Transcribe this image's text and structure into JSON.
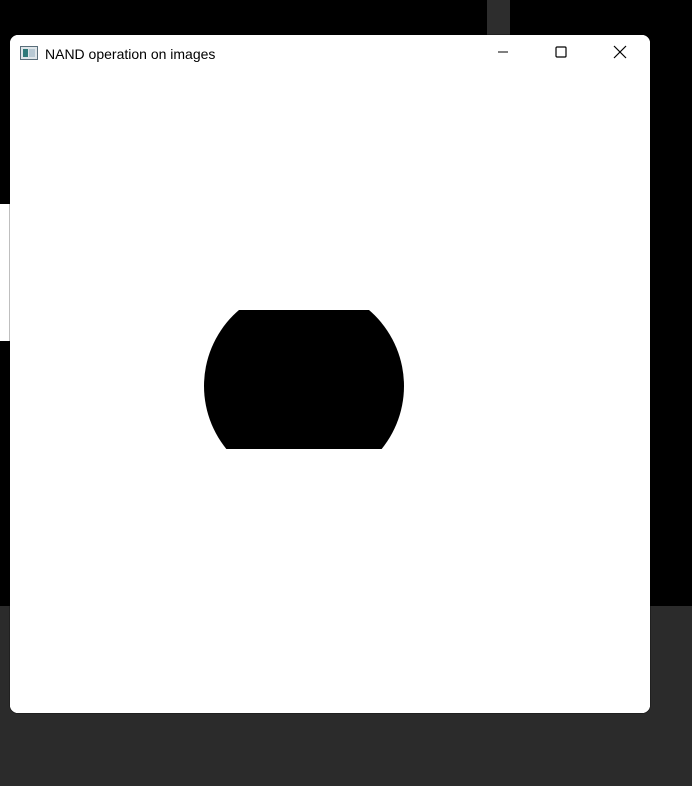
{
  "window": {
    "title": "NAND operation on images",
    "app_icon": "image-viewer-icon",
    "controls": {
      "minimize_icon": "minimize-icon",
      "maximize_icon": "maximize-icon",
      "close_icon": "close-icon"
    }
  },
  "image": {
    "background_color": "#ffffff",
    "shape_color": "#000000",
    "shape": "circle clipped top and bottom"
  },
  "desktop": {
    "background_color": "#000000",
    "taskbar_color": "#2b2b2b"
  }
}
